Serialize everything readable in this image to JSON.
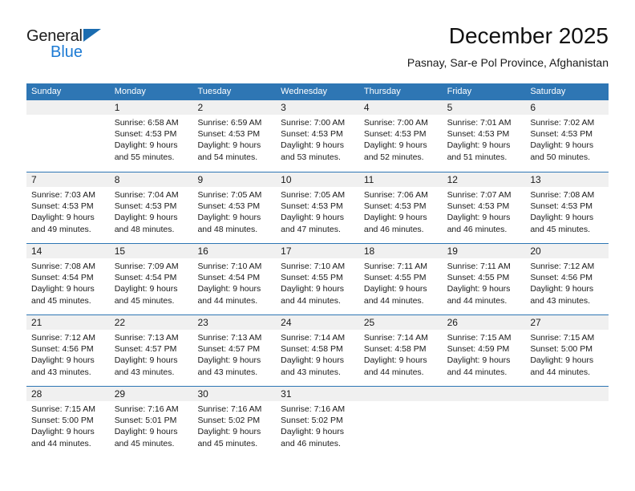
{
  "brand": {
    "word_one": "General",
    "word_two": "Blue",
    "triangle_icon": "triangle-icon",
    "accent_dark": "#1b6cb0",
    "accent_light": "#1b7ad4"
  },
  "header": {
    "title": "December 2025",
    "subtitle": "Pasnay, Sar-e Pol Province, Afghanistan"
  },
  "calendar": {
    "header_color": "#2e76b4",
    "daynum_band_color": "#f0f0f0",
    "day_names": [
      "Sunday",
      "Monday",
      "Tuesday",
      "Wednesday",
      "Thursday",
      "Friday",
      "Saturday"
    ],
    "weeks": [
      [
        {
          "day": "",
          "sunrise": "",
          "sunset": "",
          "daylight_line1": "",
          "daylight_line2": ""
        },
        {
          "day": "1",
          "sunrise": "Sunrise: 6:58 AM",
          "sunset": "Sunset: 4:53 PM",
          "daylight_line1": "Daylight: 9 hours",
          "daylight_line2": "and 55 minutes."
        },
        {
          "day": "2",
          "sunrise": "Sunrise: 6:59 AM",
          "sunset": "Sunset: 4:53 PM",
          "daylight_line1": "Daylight: 9 hours",
          "daylight_line2": "and 54 minutes."
        },
        {
          "day": "3",
          "sunrise": "Sunrise: 7:00 AM",
          "sunset": "Sunset: 4:53 PM",
          "daylight_line1": "Daylight: 9 hours",
          "daylight_line2": "and 53 minutes."
        },
        {
          "day": "4",
          "sunrise": "Sunrise: 7:00 AM",
          "sunset": "Sunset: 4:53 PM",
          "daylight_line1": "Daylight: 9 hours",
          "daylight_line2": "and 52 minutes."
        },
        {
          "day": "5",
          "sunrise": "Sunrise: 7:01 AM",
          "sunset": "Sunset: 4:53 PM",
          "daylight_line1": "Daylight: 9 hours",
          "daylight_line2": "and 51 minutes."
        },
        {
          "day": "6",
          "sunrise": "Sunrise: 7:02 AM",
          "sunset": "Sunset: 4:53 PM",
          "daylight_line1": "Daylight: 9 hours",
          "daylight_line2": "and 50 minutes."
        }
      ],
      [
        {
          "day": "7",
          "sunrise": "Sunrise: 7:03 AM",
          "sunset": "Sunset: 4:53 PM",
          "daylight_line1": "Daylight: 9 hours",
          "daylight_line2": "and 49 minutes."
        },
        {
          "day": "8",
          "sunrise": "Sunrise: 7:04 AM",
          "sunset": "Sunset: 4:53 PM",
          "daylight_line1": "Daylight: 9 hours",
          "daylight_line2": "and 48 minutes."
        },
        {
          "day": "9",
          "sunrise": "Sunrise: 7:05 AM",
          "sunset": "Sunset: 4:53 PM",
          "daylight_line1": "Daylight: 9 hours",
          "daylight_line2": "and 48 minutes."
        },
        {
          "day": "10",
          "sunrise": "Sunrise: 7:05 AM",
          "sunset": "Sunset: 4:53 PM",
          "daylight_line1": "Daylight: 9 hours",
          "daylight_line2": "and 47 minutes."
        },
        {
          "day": "11",
          "sunrise": "Sunrise: 7:06 AM",
          "sunset": "Sunset: 4:53 PM",
          "daylight_line1": "Daylight: 9 hours",
          "daylight_line2": "and 46 minutes."
        },
        {
          "day": "12",
          "sunrise": "Sunrise: 7:07 AM",
          "sunset": "Sunset: 4:53 PM",
          "daylight_line1": "Daylight: 9 hours",
          "daylight_line2": "and 46 minutes."
        },
        {
          "day": "13",
          "sunrise": "Sunrise: 7:08 AM",
          "sunset": "Sunset: 4:53 PM",
          "daylight_line1": "Daylight: 9 hours",
          "daylight_line2": "and 45 minutes."
        }
      ],
      [
        {
          "day": "14",
          "sunrise": "Sunrise: 7:08 AM",
          "sunset": "Sunset: 4:54 PM",
          "daylight_line1": "Daylight: 9 hours",
          "daylight_line2": "and 45 minutes."
        },
        {
          "day": "15",
          "sunrise": "Sunrise: 7:09 AM",
          "sunset": "Sunset: 4:54 PM",
          "daylight_line1": "Daylight: 9 hours",
          "daylight_line2": "and 45 minutes."
        },
        {
          "day": "16",
          "sunrise": "Sunrise: 7:10 AM",
          "sunset": "Sunset: 4:54 PM",
          "daylight_line1": "Daylight: 9 hours",
          "daylight_line2": "and 44 minutes."
        },
        {
          "day": "17",
          "sunrise": "Sunrise: 7:10 AM",
          "sunset": "Sunset: 4:55 PM",
          "daylight_line1": "Daylight: 9 hours",
          "daylight_line2": "and 44 minutes."
        },
        {
          "day": "18",
          "sunrise": "Sunrise: 7:11 AM",
          "sunset": "Sunset: 4:55 PM",
          "daylight_line1": "Daylight: 9 hours",
          "daylight_line2": "and 44 minutes."
        },
        {
          "day": "19",
          "sunrise": "Sunrise: 7:11 AM",
          "sunset": "Sunset: 4:55 PM",
          "daylight_line1": "Daylight: 9 hours",
          "daylight_line2": "and 44 minutes."
        },
        {
          "day": "20",
          "sunrise": "Sunrise: 7:12 AM",
          "sunset": "Sunset: 4:56 PM",
          "daylight_line1": "Daylight: 9 hours",
          "daylight_line2": "and 43 minutes."
        }
      ],
      [
        {
          "day": "21",
          "sunrise": "Sunrise: 7:12 AM",
          "sunset": "Sunset: 4:56 PM",
          "daylight_line1": "Daylight: 9 hours",
          "daylight_line2": "and 43 minutes."
        },
        {
          "day": "22",
          "sunrise": "Sunrise: 7:13 AM",
          "sunset": "Sunset: 4:57 PM",
          "daylight_line1": "Daylight: 9 hours",
          "daylight_line2": "and 43 minutes."
        },
        {
          "day": "23",
          "sunrise": "Sunrise: 7:13 AM",
          "sunset": "Sunset: 4:57 PM",
          "daylight_line1": "Daylight: 9 hours",
          "daylight_line2": "and 43 minutes."
        },
        {
          "day": "24",
          "sunrise": "Sunrise: 7:14 AM",
          "sunset": "Sunset: 4:58 PM",
          "daylight_line1": "Daylight: 9 hours",
          "daylight_line2": "and 43 minutes."
        },
        {
          "day": "25",
          "sunrise": "Sunrise: 7:14 AM",
          "sunset": "Sunset: 4:58 PM",
          "daylight_line1": "Daylight: 9 hours",
          "daylight_line2": "and 44 minutes."
        },
        {
          "day": "26",
          "sunrise": "Sunrise: 7:15 AM",
          "sunset": "Sunset: 4:59 PM",
          "daylight_line1": "Daylight: 9 hours",
          "daylight_line2": "and 44 minutes."
        },
        {
          "day": "27",
          "sunrise": "Sunrise: 7:15 AM",
          "sunset": "Sunset: 5:00 PM",
          "daylight_line1": "Daylight: 9 hours",
          "daylight_line2": "and 44 minutes."
        }
      ],
      [
        {
          "day": "28",
          "sunrise": "Sunrise: 7:15 AM",
          "sunset": "Sunset: 5:00 PM",
          "daylight_line1": "Daylight: 9 hours",
          "daylight_line2": "and 44 minutes."
        },
        {
          "day": "29",
          "sunrise": "Sunrise: 7:16 AM",
          "sunset": "Sunset: 5:01 PM",
          "daylight_line1": "Daylight: 9 hours",
          "daylight_line2": "and 45 minutes."
        },
        {
          "day": "30",
          "sunrise": "Sunrise: 7:16 AM",
          "sunset": "Sunset: 5:02 PM",
          "daylight_line1": "Daylight: 9 hours",
          "daylight_line2": "and 45 minutes."
        },
        {
          "day": "31",
          "sunrise": "Sunrise: 7:16 AM",
          "sunset": "Sunset: 5:02 PM",
          "daylight_line1": "Daylight: 9 hours",
          "daylight_line2": "and 46 minutes."
        },
        {
          "day": "",
          "sunrise": "",
          "sunset": "",
          "daylight_line1": "",
          "daylight_line2": ""
        },
        {
          "day": "",
          "sunrise": "",
          "sunset": "",
          "daylight_line1": "",
          "daylight_line2": ""
        },
        {
          "day": "",
          "sunrise": "",
          "sunset": "",
          "daylight_line1": "",
          "daylight_line2": ""
        }
      ]
    ]
  }
}
